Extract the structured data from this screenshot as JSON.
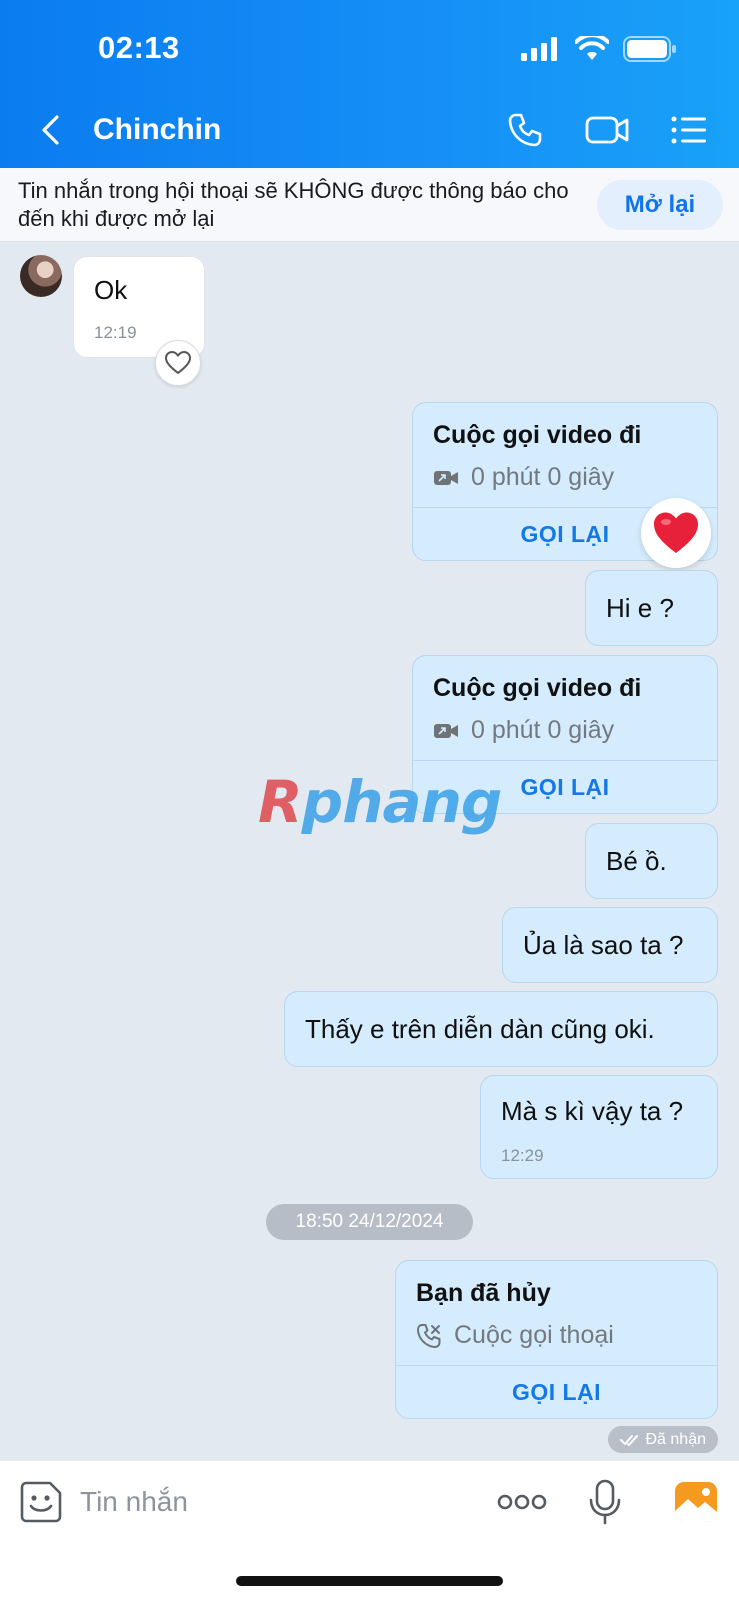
{
  "status_bar": {
    "time": "02:13"
  },
  "nav": {
    "title": "Chinchin"
  },
  "mute_banner": {
    "text": "Tin nhắn trong hội thoại sẽ KHÔNG được thông báo cho đến khi được mở lại",
    "button_label": "Mở lại"
  },
  "messages": [
    {
      "type": "text",
      "direction": "incoming",
      "text": "Ok",
      "time": "12:19"
    },
    {
      "type": "call",
      "direction": "outgoing",
      "title": "Cuộc gọi video đi",
      "subtitle": "0 phút 0 giây",
      "action": "GỌI LẠI"
    },
    {
      "type": "text",
      "direction": "outgoing",
      "text": "Hi e ?"
    },
    {
      "type": "call",
      "direction": "outgoing",
      "title": "Cuộc gọi video đi",
      "subtitle": "0 phút 0 giây",
      "action": "GỌI LẠI"
    },
    {
      "type": "text",
      "direction": "outgoing",
      "text": "Bé ồ."
    },
    {
      "type": "text",
      "direction": "outgoing",
      "text": "Ủa là sao ta ?"
    },
    {
      "type": "text",
      "direction": "outgoing",
      "text": "Thấy e trên diễn dàn cũng oki."
    },
    {
      "type": "text",
      "direction": "outgoing",
      "text": "Mà s kì vậy ta ?",
      "time": "12:29"
    },
    {
      "type": "call",
      "direction": "outgoing",
      "title": "Bạn đã hủy",
      "subtitle": "Cuộc gọi thoại",
      "action": "GỌI LẠI"
    }
  ],
  "date_separator": "18:50 24/12/2024",
  "delivery_status": "Đã nhận",
  "watermark": {
    "first": "R",
    "rest": "phang"
  },
  "composer": {
    "placeholder": "Tin nhắn"
  },
  "colors": {
    "header_blue": "#0a7cf0",
    "bubble_out": "#d4ecfd",
    "action_blue": "#1478e6",
    "heart": "#e8213a"
  }
}
